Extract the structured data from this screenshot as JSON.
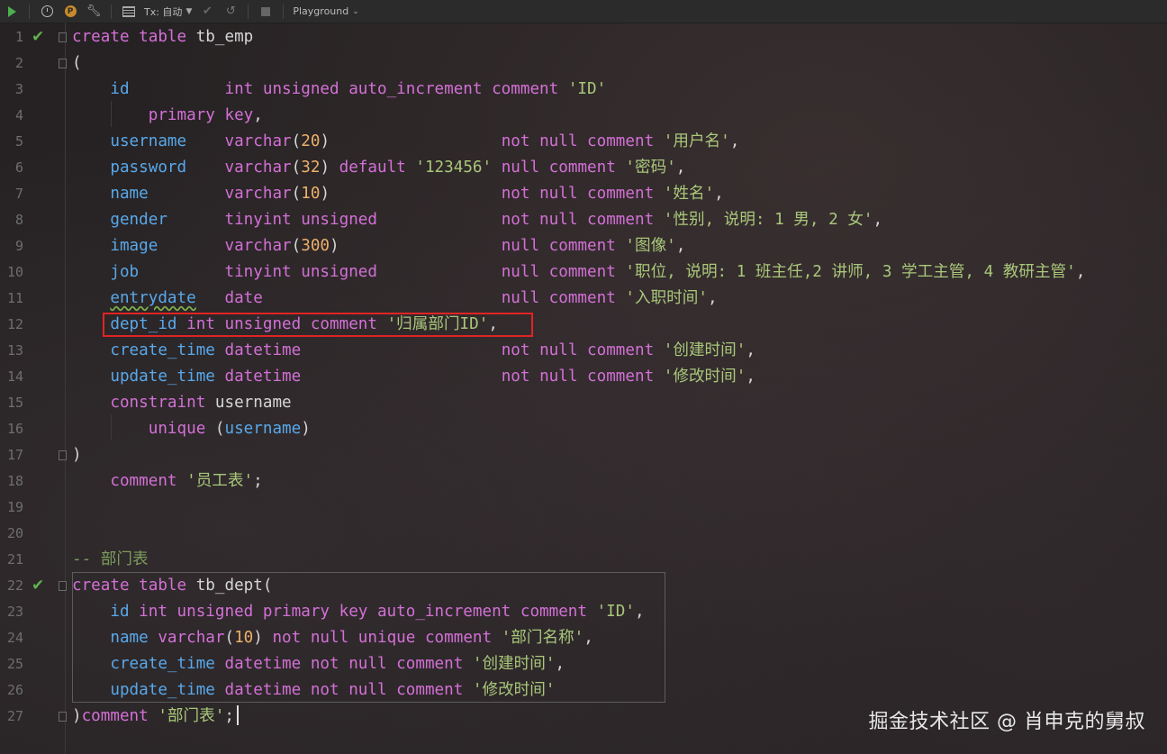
{
  "toolbar": {
    "tx_label": "Tx: 自动",
    "playground_label": "Playground"
  },
  "lines": [
    {
      "n": "1",
      "check": true,
      "fold": true,
      "t": [
        [
          "kw",
          "create table "
        ],
        [
          "plain",
          "tb_emp"
        ]
      ]
    },
    {
      "n": "2",
      "fold": true,
      "t": [
        [
          "plain",
          "("
        ]
      ]
    },
    {
      "n": "3",
      "t": [
        [
          "plain",
          "    "
        ],
        [
          "fld",
          "id"
        ],
        [
          "plain",
          "          "
        ],
        [
          "kw",
          "int unsigned auto_increment comment "
        ],
        [
          "str",
          "'ID'"
        ]
      ]
    },
    {
      "n": "4",
      "t": [
        [
          "plain",
          "        "
        ],
        [
          "kw",
          "primary key"
        ],
        [
          "plain",
          ","
        ]
      ]
    },
    {
      "n": "5",
      "t": [
        [
          "plain",
          "    "
        ],
        [
          "fld",
          "username"
        ],
        [
          "plain",
          "    "
        ],
        [
          "kw",
          "varchar"
        ],
        [
          "plain",
          "("
        ],
        [
          "num",
          "20"
        ],
        [
          "plain",
          ")                  "
        ],
        [
          "kw",
          "not null comment "
        ],
        [
          "str",
          "'用户名'"
        ],
        [
          "plain",
          ","
        ]
      ]
    },
    {
      "n": "6",
      "t": [
        [
          "plain",
          "    "
        ],
        [
          "fld",
          "password"
        ],
        [
          "plain",
          "    "
        ],
        [
          "kw",
          "varchar"
        ],
        [
          "plain",
          "("
        ],
        [
          "num",
          "32"
        ],
        [
          "plain",
          ") "
        ],
        [
          "kw",
          "default "
        ],
        [
          "str",
          "'123456'"
        ],
        [
          "plain",
          " "
        ],
        [
          "kw",
          "null comment "
        ],
        [
          "str",
          "'密码'"
        ],
        [
          "plain",
          ","
        ]
      ]
    },
    {
      "n": "7",
      "t": [
        [
          "plain",
          "    "
        ],
        [
          "fld",
          "name"
        ],
        [
          "plain",
          "        "
        ],
        [
          "kw",
          "varchar"
        ],
        [
          "plain",
          "("
        ],
        [
          "num",
          "10"
        ],
        [
          "plain",
          ")                  "
        ],
        [
          "kw",
          "not null comment "
        ],
        [
          "str",
          "'姓名'"
        ],
        [
          "plain",
          ","
        ]
      ]
    },
    {
      "n": "8",
      "t": [
        [
          "plain",
          "    "
        ],
        [
          "fld",
          "gender"
        ],
        [
          "plain",
          "      "
        ],
        [
          "kw",
          "tinyint unsigned"
        ],
        [
          "plain",
          "             "
        ],
        [
          "kw",
          "not null comment "
        ],
        [
          "str",
          "'性别, 说明: 1 男, 2 女'"
        ],
        [
          "plain",
          ","
        ]
      ]
    },
    {
      "n": "9",
      "t": [
        [
          "plain",
          "    "
        ],
        [
          "fld",
          "image"
        ],
        [
          "plain",
          "       "
        ],
        [
          "kw",
          "varchar"
        ],
        [
          "plain",
          "("
        ],
        [
          "num",
          "300"
        ],
        [
          "plain",
          ")                 "
        ],
        [
          "kw",
          "null comment "
        ],
        [
          "str",
          "'图像'"
        ],
        [
          "plain",
          ","
        ]
      ]
    },
    {
      "n": "10",
      "t": [
        [
          "plain",
          "    "
        ],
        [
          "fld",
          "job"
        ],
        [
          "plain",
          "         "
        ],
        [
          "kw",
          "tinyint unsigned"
        ],
        [
          "plain",
          "             "
        ],
        [
          "kw",
          "null comment "
        ],
        [
          "str",
          "'职位, 说明: 1 班主任,2 讲师, 3 学工主管, 4 教研主管'"
        ],
        [
          "plain",
          ","
        ]
      ]
    },
    {
      "n": "11",
      "t": [
        [
          "plain",
          "    "
        ],
        [
          "fldw",
          "entrydate"
        ],
        [
          "plain",
          "   "
        ],
        [
          "kw",
          "date"
        ],
        [
          "plain",
          "                         "
        ],
        [
          "kw",
          "null comment "
        ],
        [
          "str",
          "'入职时间'"
        ],
        [
          "plain",
          ","
        ]
      ]
    },
    {
      "n": "12",
      "t": [
        [
          "plain",
          "    "
        ],
        [
          "fld",
          "dept_id"
        ],
        [
          "plain",
          " "
        ],
        [
          "kw",
          "int unsigned comment "
        ],
        [
          "str",
          "'归属部门ID'"
        ],
        [
          "plain",
          ","
        ]
      ]
    },
    {
      "n": "13",
      "t": [
        [
          "plain",
          "    "
        ],
        [
          "fld",
          "create_time"
        ],
        [
          "plain",
          " "
        ],
        [
          "kw",
          "datetime"
        ],
        [
          "plain",
          "                     "
        ],
        [
          "kw",
          "not null comment "
        ],
        [
          "str",
          "'创建时间'"
        ],
        [
          "plain",
          ","
        ]
      ]
    },
    {
      "n": "14",
      "t": [
        [
          "plain",
          "    "
        ],
        [
          "fld",
          "update_time"
        ],
        [
          "plain",
          " "
        ],
        [
          "kw",
          "datetime"
        ],
        [
          "plain",
          "                     "
        ],
        [
          "kw",
          "not null comment "
        ],
        [
          "str",
          "'修改时间'"
        ],
        [
          "plain",
          ","
        ]
      ]
    },
    {
      "n": "15",
      "t": [
        [
          "plain",
          "    "
        ],
        [
          "kw",
          "constraint "
        ],
        [
          "plain",
          "username"
        ]
      ]
    },
    {
      "n": "16",
      "t": [
        [
          "plain",
          "        "
        ],
        [
          "kw",
          "unique "
        ],
        [
          "plain",
          "("
        ],
        [
          "fld",
          "username"
        ],
        [
          "plain",
          ")"
        ]
      ]
    },
    {
      "n": "17",
      "fold": true,
      "t": [
        [
          "plain",
          ")"
        ]
      ]
    },
    {
      "n": "18",
      "t": [
        [
          "plain",
          "    "
        ],
        [
          "kw",
          "comment "
        ],
        [
          "str",
          "'员工表'"
        ],
        [
          "plain",
          ";"
        ]
      ]
    },
    {
      "n": "19",
      "t": []
    },
    {
      "n": "20",
      "t": []
    },
    {
      "n": "21",
      "t": [
        [
          "cmt",
          "-- 部门表"
        ]
      ]
    },
    {
      "n": "22",
      "check": true,
      "fold": true,
      "t": [
        [
          "kw",
          "create table "
        ],
        [
          "plain",
          "tb_dept("
        ]
      ]
    },
    {
      "n": "23",
      "t": [
        [
          "plain",
          "    "
        ],
        [
          "fld",
          "id"
        ],
        [
          "plain",
          " "
        ],
        [
          "kw",
          "int unsigned primary key auto_increment comment "
        ],
        [
          "str",
          "'ID'"
        ],
        [
          "plain",
          ","
        ]
      ]
    },
    {
      "n": "24",
      "t": [
        [
          "plain",
          "    "
        ],
        [
          "fld",
          "name"
        ],
        [
          "plain",
          " "
        ],
        [
          "kw",
          "varchar"
        ],
        [
          "plain",
          "("
        ],
        [
          "num",
          "10"
        ],
        [
          "plain",
          ") "
        ],
        [
          "kw",
          "not null unique comment "
        ],
        [
          "str",
          "'部门名称'"
        ],
        [
          "plain",
          ","
        ]
      ]
    },
    {
      "n": "25",
      "t": [
        [
          "plain",
          "    "
        ],
        [
          "fld",
          "create_time"
        ],
        [
          "plain",
          " "
        ],
        [
          "kw",
          "datetime not null comment "
        ],
        [
          "str",
          "'创建时间'"
        ],
        [
          "plain",
          ","
        ]
      ]
    },
    {
      "n": "26",
      "t": [
        [
          "plain",
          "    "
        ],
        [
          "fld",
          "update_time"
        ],
        [
          "plain",
          " "
        ],
        [
          "kw",
          "datetime not null comment "
        ],
        [
          "str",
          "'修改时间'"
        ]
      ]
    },
    {
      "n": "27",
      "fold": true,
      "t": [
        [
          "plain",
          ")"
        ],
        [
          "kw",
          "comment "
        ],
        [
          "str",
          "'部门表'"
        ],
        [
          "plain",
          ";"
        ]
      ]
    }
  ],
  "watermark": "掘金技术社区 @ 肖申克的舅叔"
}
